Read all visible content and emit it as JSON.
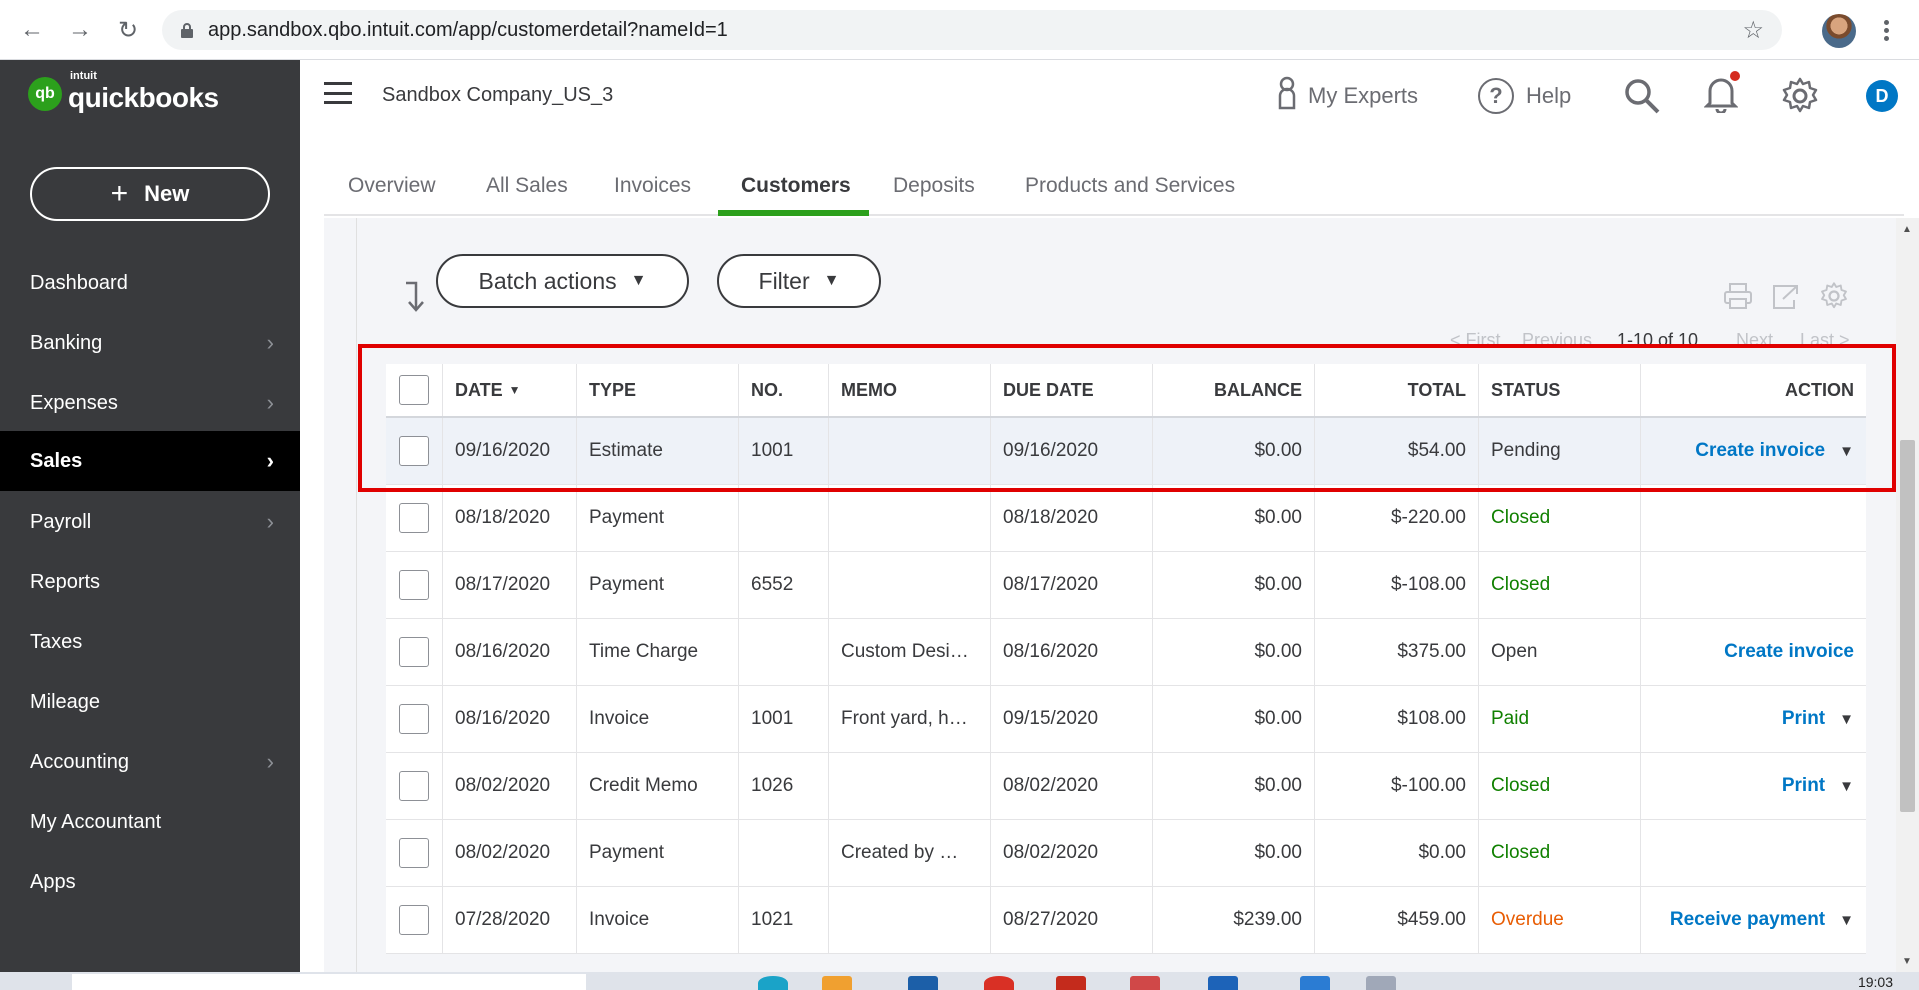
{
  "browser": {
    "url": "app.sandbox.qbo.intuit.com/app/customerdetail?nameId=1"
  },
  "sidebar": {
    "logo_small": "intuit",
    "logo_text": "quickbooks",
    "new_label": "New",
    "items": [
      {
        "label": "Dashboard"
      },
      {
        "label": "Banking"
      },
      {
        "label": "Expenses"
      },
      {
        "label": "Sales"
      },
      {
        "label": "Payroll"
      },
      {
        "label": "Reports"
      },
      {
        "label": "Taxes"
      },
      {
        "label": "Mileage"
      },
      {
        "label": "Accounting"
      },
      {
        "label": "My Accountant"
      },
      {
        "label": "Apps"
      }
    ]
  },
  "header": {
    "company": "Sandbox Company_US_3",
    "my_experts": "My Experts",
    "help": "Help",
    "avatar_initial": "D"
  },
  "tabs": [
    {
      "label": "Overview"
    },
    {
      "label": "All Sales"
    },
    {
      "label": "Invoices"
    },
    {
      "label": "Customers"
    },
    {
      "label": "Deposits"
    },
    {
      "label": "Products and Services"
    }
  ],
  "toolbar": {
    "batch_actions": "Batch actions",
    "filter": "Filter"
  },
  "pager": {
    "first": "< First",
    "previous": "Previous",
    "count": "1-10 of 10",
    "next": "Next",
    "last": "Last >"
  },
  "table": {
    "columns": [
      "DATE",
      "TYPE",
      "NO.",
      "MEMO",
      "DUE DATE",
      "BALANCE",
      "TOTAL",
      "STATUS",
      "ACTION"
    ],
    "rows": [
      {
        "date": "09/16/2020",
        "type": "Estimate",
        "no": "1001",
        "memo": "",
        "due": "09/16/2020",
        "balance": "$0.00",
        "total": "$54.00",
        "status": "Pending",
        "action": "Create invoice"
      },
      {
        "date": "08/18/2020",
        "type": "Payment",
        "no": "",
        "memo": "",
        "due": "08/18/2020",
        "balance": "$0.00",
        "total": "$-220.00",
        "status": "Closed",
        "action": ""
      },
      {
        "date": "08/17/2020",
        "type": "Payment",
        "no": "6552",
        "memo": "",
        "due": "08/17/2020",
        "balance": "$0.00",
        "total": "$-108.00",
        "status": "Closed",
        "action": ""
      },
      {
        "date": "08/16/2020",
        "type": "Time Charge",
        "no": "",
        "memo": "Custom Desi…",
        "due": "08/16/2020",
        "balance": "$0.00",
        "total": "$375.00",
        "status": "Open",
        "action": "Create invoice"
      },
      {
        "date": "08/16/2020",
        "type": "Invoice",
        "no": "1001",
        "memo": "Front yard, h…",
        "due": "09/15/2020",
        "balance": "$0.00",
        "total": "$108.00",
        "status": "Paid",
        "action": "Print"
      },
      {
        "date": "08/02/2020",
        "type": "Credit Memo",
        "no": "1026",
        "memo": "",
        "due": "08/02/2020",
        "balance": "$0.00",
        "total": "$-100.00",
        "status": "Closed",
        "action": "Print"
      },
      {
        "date": "08/02/2020",
        "type": "Payment",
        "no": "",
        "memo": "Created by …",
        "due": "08/02/2020",
        "balance": "$0.00",
        "total": "$0.00",
        "status": "Closed",
        "action": ""
      },
      {
        "date": "07/28/2020",
        "type": "Invoice",
        "no": "1021",
        "memo": "",
        "due": "08/27/2020",
        "balance": "$239.00",
        "total": "$459.00",
        "status": "Overdue",
        "action": "Receive payment"
      }
    ]
  },
  "taskbar": {
    "clock": "19:03"
  },
  "colors": {
    "sidebar_bg": "#393a3d",
    "brand_green": "#2ca01c",
    "link_blue": "#0077c5",
    "status_green": "#108000",
    "status_overdue": "#e85d04",
    "highlight_red": "#e00000"
  }
}
